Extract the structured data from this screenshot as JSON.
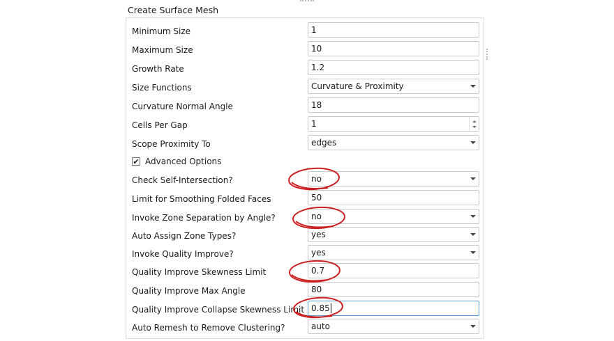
{
  "panel": {
    "title": "Create Surface Mesh"
  },
  "fields": [
    {
      "label": "Minimum Size",
      "value": "1",
      "kind": "text"
    },
    {
      "label": "Maximum Size",
      "value": "10",
      "kind": "text"
    },
    {
      "label": "Growth Rate",
      "value": "1.2",
      "kind": "text"
    },
    {
      "label": "Size Functions",
      "value": "Curvature & Proximity",
      "kind": "dropdown"
    },
    {
      "label": "Curvature Normal Angle",
      "value": "18",
      "kind": "text"
    },
    {
      "label": "Cells Per Gap",
      "value": "1",
      "kind": "spinner"
    },
    {
      "label": "Scope Proximity To",
      "value": "edges",
      "kind": "dropdown"
    }
  ],
  "advanced": {
    "label": "Advanced Options",
    "checked": true
  },
  "advanced_fields": [
    {
      "label": "Check Self-Intersection?",
      "value": "no",
      "kind": "dropdown"
    },
    {
      "label": "Limit for Smoothing Folded Faces",
      "value": "50",
      "kind": "text"
    },
    {
      "label": "Invoke Zone Separation by Angle?",
      "value": "no",
      "kind": "dropdown"
    },
    {
      "label": "Auto Assign Zone Types?",
      "value": "yes",
      "kind": "dropdown"
    },
    {
      "label": "Invoke Quality Improve?",
      "value": "yes",
      "kind": "dropdown"
    },
    {
      "label": "Quality Improve Skewness Limit",
      "value": "0.7",
      "kind": "text"
    },
    {
      "label": "Quality Improve Max Angle",
      "value": "80",
      "kind": "text"
    },
    {
      "label": "Quality Improve Collapse Skewness Limit",
      "value": "0.85",
      "kind": "text"
    },
    {
      "label": "Auto Remesh to Remove Clustering?",
      "value": "auto",
      "kind": "dropdown"
    }
  ],
  "colors": {
    "annotation": "#cc1f1f",
    "focus": "#5b9bd5"
  },
  "icons": {
    "dropdown": "chevron-down-icon",
    "check": "checkmark-icon"
  }
}
